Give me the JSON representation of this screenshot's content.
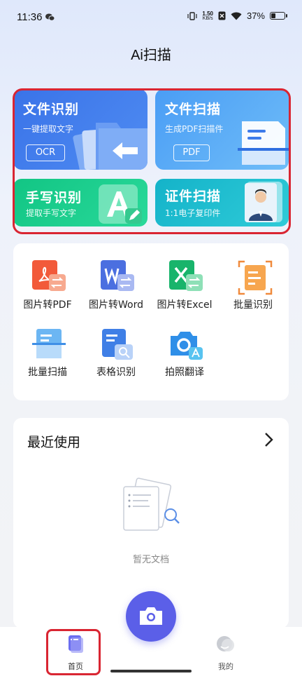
{
  "status_bar": {
    "time": "11:36",
    "speed_value": "1.50",
    "speed_unit": "KB/s",
    "battery": "37%",
    "battery_level": 0.37
  },
  "header": {
    "title": "Ai扫描"
  },
  "features": {
    "ocr": {
      "title": "文件识别",
      "subtitle": "一键提取文字",
      "tag": "OCR"
    },
    "scan": {
      "title": "文件扫描",
      "subtitle": "生成PDF扫描件",
      "tag": "PDF"
    },
    "handwriting": {
      "title": "手写识别",
      "subtitle": "提取手写文字"
    },
    "certificate": {
      "title": "证件扫描",
      "subtitle": "1:1电子复印件"
    }
  },
  "tools": [
    {
      "label": "图片转PDF",
      "icon": "pdf-convert-icon"
    },
    {
      "label": "图片转Word",
      "icon": "word-convert-icon"
    },
    {
      "label": "图片转Excel",
      "icon": "excel-convert-icon"
    },
    {
      "label": "批量识别",
      "icon": "batch-recognize-icon"
    },
    {
      "label": "批量扫描",
      "icon": "batch-scan-icon"
    },
    {
      "label": "表格识别",
      "icon": "table-recognize-icon"
    },
    {
      "label": "拍照翻译",
      "icon": "photo-translate-icon"
    }
  ],
  "recent": {
    "title": "最近使用",
    "empty_text": "暂无文档"
  },
  "bottom_nav": {
    "home_label": "首页",
    "mine_label": "我的"
  },
  "colors": {
    "accent": "#5b5fe8",
    "highlight": "#d92532"
  }
}
